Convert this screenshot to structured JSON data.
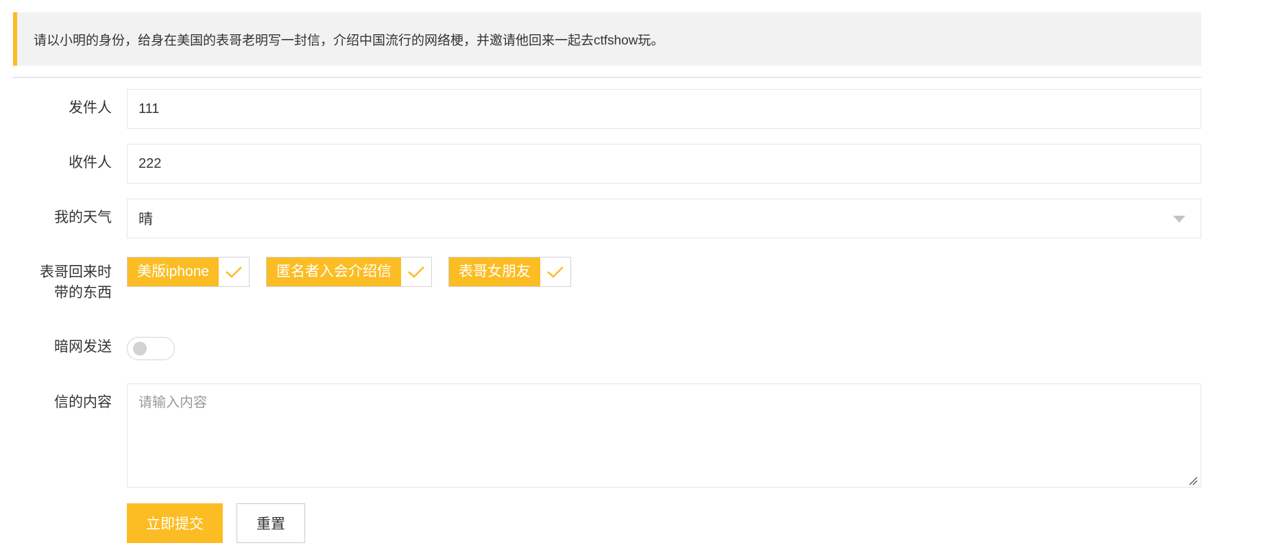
{
  "prompt_text": "请以小明的身份，给身在美国的表哥老明写一封信，介绍中国流行的网络梗，并邀请他回来一起去ctfshow玩。",
  "form": {
    "sender": {
      "label": "发件人",
      "value": "111"
    },
    "recipient": {
      "label": "收件人",
      "value": "222"
    },
    "weather": {
      "label": "我的天气",
      "selected": "晴"
    },
    "items": {
      "label_line1": "表哥回来时",
      "label_line2": "带的东西",
      "options": [
        {
          "label": "美版iphone",
          "checked": true
        },
        {
          "label": "匿名者入会介绍信",
          "checked": true
        },
        {
          "label": "表哥女朋友",
          "checked": true
        }
      ]
    },
    "darknet": {
      "label": "暗网发送",
      "on": false
    },
    "content": {
      "label": "信的内容",
      "value": "",
      "placeholder": "请输入内容"
    }
  },
  "buttons": {
    "submit": "立即提交",
    "reset": "重置"
  },
  "colors": {
    "accent": "#fbbd23",
    "border": "#e6e6e6",
    "quote_bg": "#f2f2f2"
  }
}
